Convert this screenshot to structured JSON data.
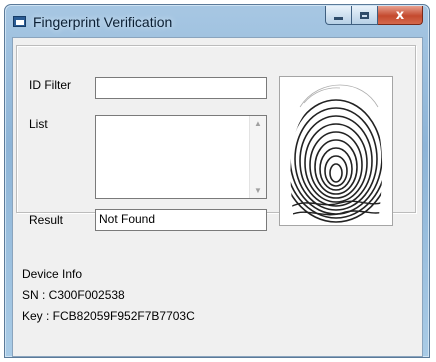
{
  "window": {
    "title": "Fingerprint Verification",
    "icon": "app-icon",
    "close_glyph": "x"
  },
  "form": {
    "id_filter_label": "ID Filter",
    "id_filter_value": "",
    "list_label": "List",
    "list_items": [],
    "result_label": "Result",
    "result_value": "Not Found"
  },
  "fingerprint": {
    "image": "fingerprint-scan"
  },
  "device": {
    "heading": "Device Info",
    "sn_line": "SN : C300F002538",
    "key_line": "Key : FCB82059F952F7B7703C"
  },
  "colors": {
    "titlebar": "#9cbfe0",
    "close_button": "#c44a2e",
    "client_bg": "#f0f0f0"
  }
}
